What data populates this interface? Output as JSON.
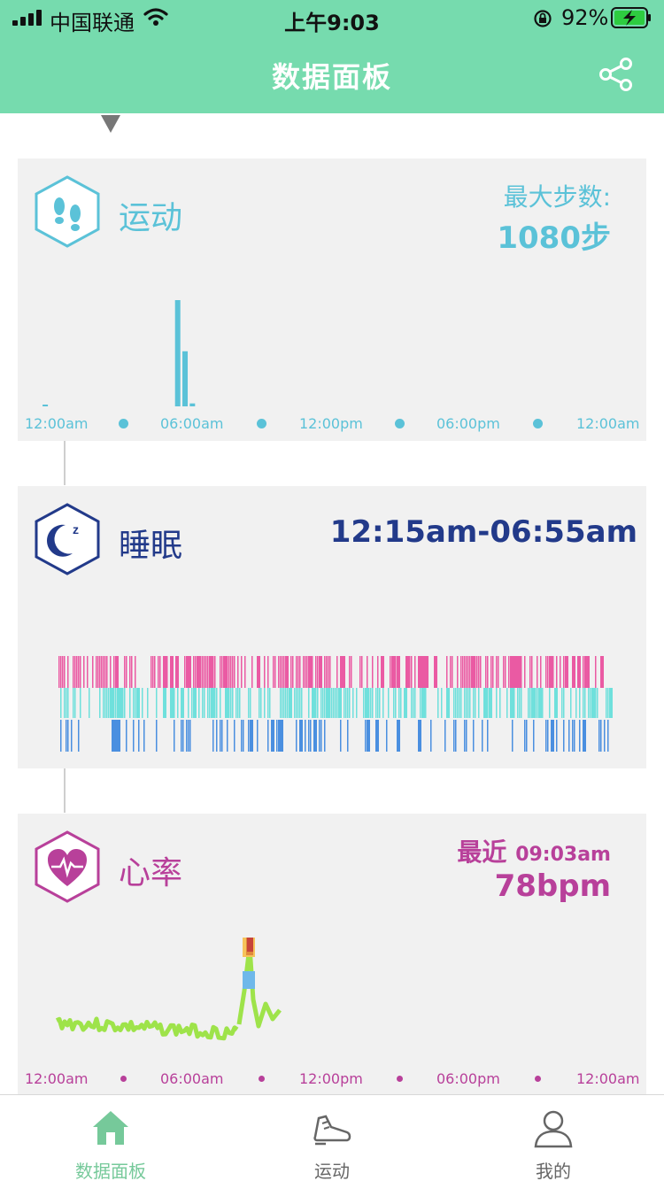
{
  "status_bar": {
    "carrier": "中国联通",
    "time": "上午9:03",
    "battery": "92%"
  },
  "header": {
    "title": "数据面板"
  },
  "colors": {
    "header_bg": "#76dbae",
    "activity": "#5bc2d8",
    "sleep": "#223a8a",
    "sleep_deep": "#ea5aa3",
    "sleep_light": "#6fe0dc",
    "sleep_awake": "#4a8fe0",
    "heart": "#b8409a",
    "heart_line": "#9ee34a",
    "tab_active": "#76c99a",
    "tab_inactive": "#666666"
  },
  "activity": {
    "title": "运动",
    "max_label": "最大步数:",
    "max_value": "1080步",
    "axis": [
      "12:00am",
      "06:00am",
      "12:00pm",
      "06:00pm",
      "12:00am"
    ],
    "chart_data": {
      "type": "bar",
      "x_unit": "hours since 12:00am",
      "xlim": [
        0,
        24
      ],
      "ylim": [
        0,
        1080
      ],
      "x": [
        0.4,
        5.8,
        6.1,
        6.4
      ],
      "values": [
        5,
        1080,
        560,
        30
      ]
    }
  },
  "sleep": {
    "title": "睡眠",
    "range": "12:15am-06:55am"
  },
  "heart": {
    "title": "心率",
    "latest_label": "最近",
    "latest_time": "09:03am",
    "latest_value": "78bpm",
    "axis": [
      "12:00am",
      "06:00am",
      "12:00pm",
      "06:00pm",
      "12:00am"
    ]
  },
  "tabs": [
    {
      "label": "数据面板",
      "icon": "home-icon",
      "active": true
    },
    {
      "label": "运动",
      "icon": "shoe-icon",
      "active": false
    },
    {
      "label": "我的",
      "icon": "user-icon",
      "active": false
    }
  ]
}
